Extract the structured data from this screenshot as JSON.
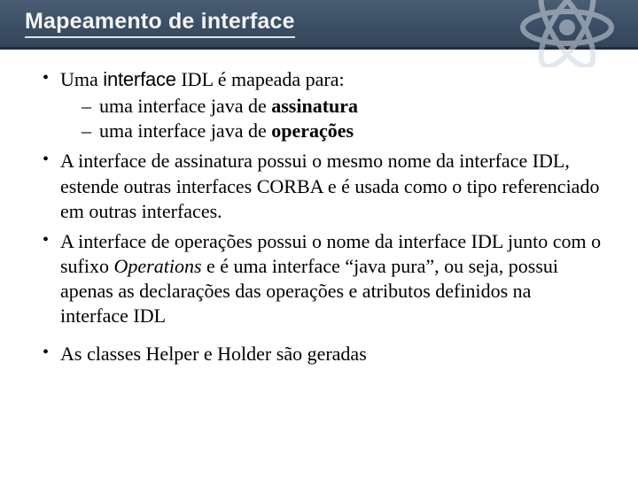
{
  "header": {
    "title": "Mapeamento de interface"
  },
  "body": {
    "b1_p1": "Uma ",
    "b1_if": "interface",
    "b1_p2": " IDL é mapeada para:",
    "s1_p1": "uma interface java de ",
    "s1_b": "assinatura",
    "s2_p1": "uma interface java de ",
    "s2_b": "operações",
    "b2": "A interface de assinatura possui o mesmo nome da interface IDL, estende outras interfaces CORBA e é usada como o tipo referenciado em outras interfaces.",
    "b3_p1": "A interface de operações possui o nome da interface IDL junto com o sufixo ",
    "b3_it": "Operations",
    "b3_p2": " e é uma interface “java pura”, ou seja, possui apenas as declarações das operações e atributos definidos na interface IDL",
    "b4": "As classes Helper e Holder são geradas"
  }
}
